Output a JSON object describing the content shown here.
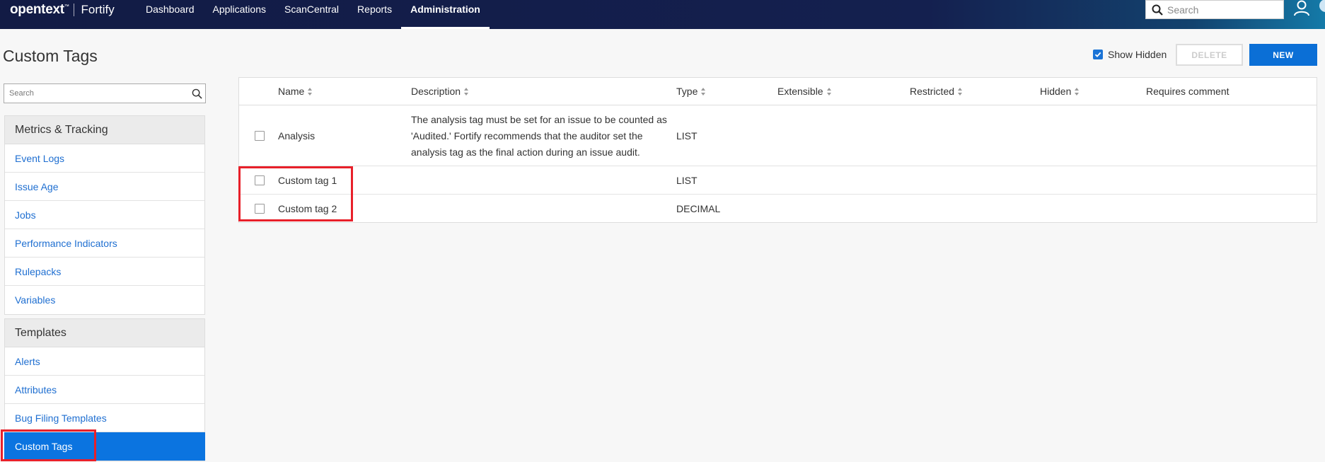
{
  "header": {
    "logo": "opentext",
    "logo_tm": "™",
    "product": "Fortify",
    "nav": [
      "Dashboard",
      "Applications",
      "ScanCentral",
      "Reports",
      "Administration"
    ],
    "active_nav": "Administration",
    "search_placeholder": "Search"
  },
  "page": {
    "title": "Custom Tags",
    "show_hidden_label": "Show Hidden",
    "show_hidden_checked": true,
    "delete_label": "DELETE",
    "new_label": "NEW"
  },
  "sidebar": {
    "search_placeholder": "Search",
    "groups": [
      {
        "title": "Metrics & Tracking",
        "items": [
          "Event Logs",
          "Issue Age",
          "Jobs",
          "Performance Indicators",
          "Rulepacks",
          "Variables"
        ]
      },
      {
        "title": "Templates",
        "items": [
          "Alerts",
          "Attributes",
          "Bug Filing Templates",
          "Custom Tags"
        ]
      }
    ],
    "active_item": "Custom Tags"
  },
  "table": {
    "columns": [
      "Name",
      "Description",
      "Type",
      "Extensible",
      "Restricted",
      "Hidden",
      "Requires comment"
    ],
    "rows": [
      {
        "name": "Analysis",
        "description": "The analysis tag must be set for an issue to be counted as 'Audited.' Fortify recommends that the auditor set the analysis tag as the final action during an issue audit.",
        "type": "LIST",
        "extensible": "",
        "restricted": "",
        "hidden": "",
        "requires_comment": ""
      },
      {
        "name": "Custom tag 1",
        "description": "",
        "type": "LIST",
        "extensible": "",
        "restricted": "",
        "hidden": "",
        "requires_comment": ""
      },
      {
        "name": "Custom tag 2",
        "description": "",
        "type": "DECIMAL",
        "extensible": "",
        "restricted": "",
        "hidden": "",
        "requires_comment": ""
      }
    ]
  },
  "colors": {
    "nav_bg": "#14204f",
    "accent": "#0b74e0",
    "link": "#1f6fd1",
    "highlight": "#e8202a"
  }
}
